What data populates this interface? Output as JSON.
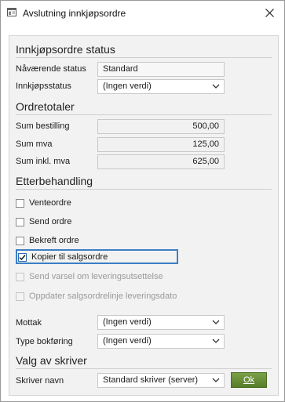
{
  "window": {
    "title": "Avslutning innkjøpsordre",
    "close_glyph": "✕"
  },
  "status_section": {
    "heading": "Innkjøpsordre status",
    "current_status_label": "Nåværende status",
    "current_status_value": "Standard",
    "purchase_status_label": "Innkjøpsstatus",
    "purchase_status_value": "(Ingen verdi)"
  },
  "totals_section": {
    "heading": "Ordretotaler",
    "rows": [
      {
        "label": "Sum bestilling",
        "value": "500,00"
      },
      {
        "label": "Sum mva",
        "value": "125,00"
      },
      {
        "label": "Sum inkl. mva",
        "value": "625,00"
      }
    ]
  },
  "post_section": {
    "heading": "Etterbehandling",
    "options": [
      {
        "label": "Venteordre",
        "checked": false,
        "enabled": true
      },
      {
        "label": "Send ordre",
        "checked": false,
        "enabled": true
      },
      {
        "label": "Bekreft ordre",
        "checked": false,
        "enabled": true
      },
      {
        "label": "Kopier til salgsordre",
        "checked": true,
        "enabled": true
      },
      {
        "label": "Send varsel om leveringsutsettelse",
        "checked": false,
        "enabled": false
      },
      {
        "label": "Oppdater salgsordrelinje leveringsdato",
        "checked": false,
        "enabled": false
      }
    ],
    "receiver_label": "Mottak",
    "receiver_value": "(Ingen verdi)",
    "posting_type_label": "Type bokføring",
    "posting_type_value": "(Ingen verdi)"
  },
  "printer_section": {
    "heading": "Valg av skriver",
    "printer_label": "Skriver navn",
    "printer_value": "Standard skriver (server)",
    "ok_label": "Ok"
  },
  "colors": {
    "accent": "#3c7fc6",
    "ok_button": "#6a9438"
  },
  "icons": {
    "window": "document-icon",
    "close": "close-icon",
    "dropdown": "chevron-down-icon",
    "check": "check-icon"
  }
}
